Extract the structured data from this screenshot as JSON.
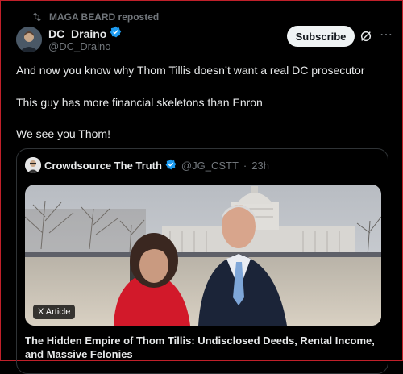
{
  "repost": {
    "label": "MAGA BEARD reposted"
  },
  "author": {
    "name": "DC_Draino",
    "handle": "@DC_Draino",
    "verified": true
  },
  "actions": {
    "subscribe_label": "Subscribe",
    "grok_icon": "grok-icon",
    "more_icon": "more-icon"
  },
  "post": {
    "lines": [
      "And now you know why Thom Tillis doesn’t want a real DC prosecutor",
      "This guy has more financial skeletons than Enron",
      "We see you Thom!"
    ]
  },
  "quote": {
    "name": "Crowdsource The Truth",
    "handle": "@JG_CSTT",
    "separator": "·",
    "time": "23h",
    "verified": true,
    "card": {
      "badge": "X Article",
      "title": "The Hidden Empire of Thom Tillis: Undisclosed Deeds, Rental Income, and Massive Felonies"
    }
  },
  "colors": {
    "verified": "#1d9bf0",
    "muted": "#71767b",
    "background": "#000000"
  }
}
